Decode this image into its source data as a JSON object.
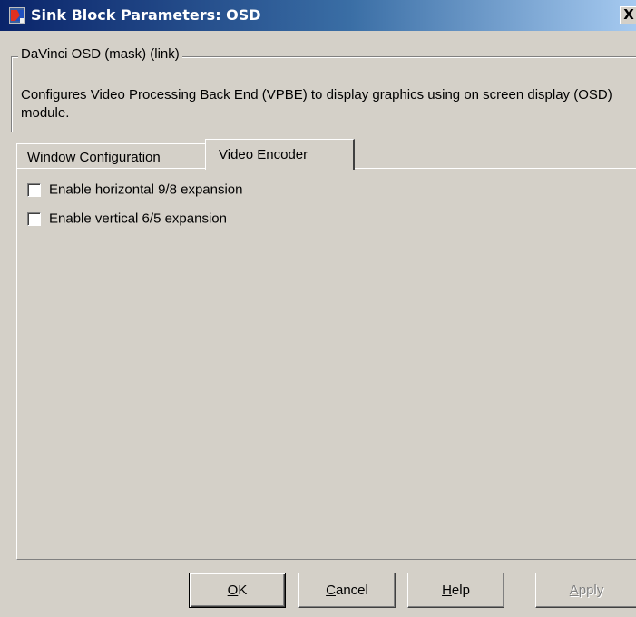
{
  "window": {
    "title": "Sink Block Parameters: OSD",
    "close_label": "X"
  },
  "group": {
    "legend": "DaVinci OSD (mask) (link)",
    "description": "Configures Video Processing Back End (VPBE) to display graphics using on screen display (OSD) module."
  },
  "tabs": [
    {
      "label": "Window Configuration",
      "selected": false
    },
    {
      "label": "Video Encoder",
      "selected": true
    }
  ],
  "options": [
    {
      "label": "Enable horizontal 9/8 expansion",
      "checked": false
    },
    {
      "label": "Enable vertical 6/5 expansion",
      "checked": false
    }
  ],
  "buttons": {
    "ok": {
      "mnemonic": "O",
      "rest": "K"
    },
    "cancel": {
      "mnemonic": "C",
      "rest": "ancel"
    },
    "help": {
      "mnemonic": "H",
      "rest": "elp"
    },
    "apply": {
      "mnemonic": "A",
      "rest": "pply",
      "enabled": false
    }
  },
  "colors": {
    "title_bar_start": "#0a246a",
    "title_bar_end": "#a6caf0",
    "dialog_face": "#d4d0c8",
    "disabled_text": "#808080"
  },
  "icons": {
    "app": "simulink-block-icon",
    "close": "close-icon"
  }
}
